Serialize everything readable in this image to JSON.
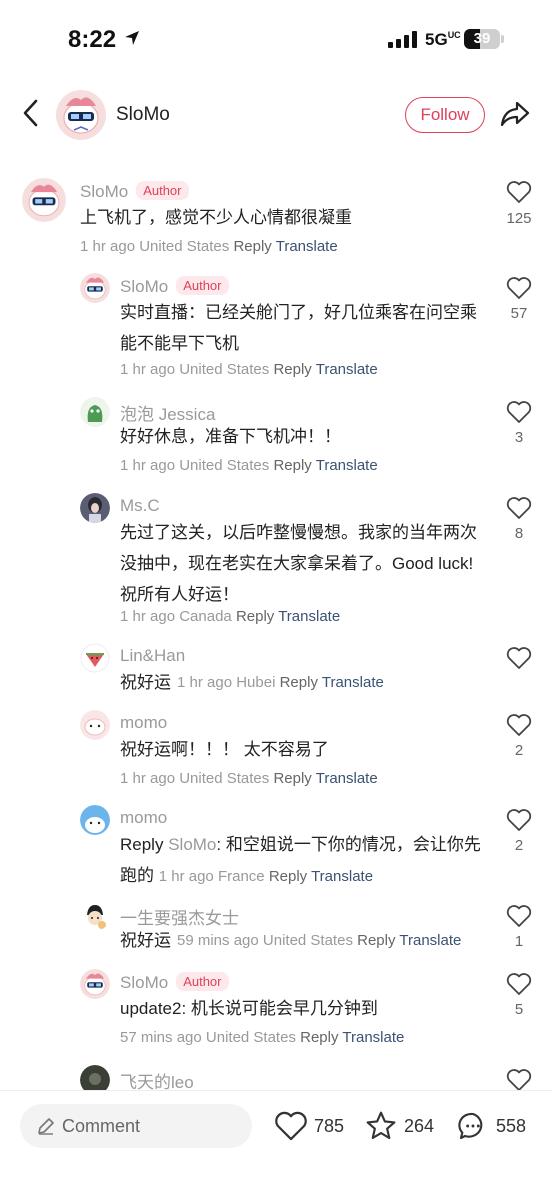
{
  "status_bar": {
    "time": "8:22",
    "network": "5G",
    "network_sub": "UC",
    "battery": "39"
  },
  "header": {
    "name": "SloMo",
    "follow_label": "Follow"
  },
  "colors": {
    "accent": "#e0405a",
    "author_badge_bg": "#fde9ec",
    "translate": "#3b5273",
    "meta": "#999999"
  },
  "meta_labels": {
    "reply": "Reply",
    "translate": "Translate",
    "author": "Author"
  },
  "comments": [
    {
      "name": "SloMo",
      "author": true,
      "text": "上飞机了，感觉不少人心情都很凝重",
      "time": "1 hr ago",
      "location": "United States",
      "likes": "125"
    },
    {
      "name": "SloMo",
      "author": true,
      "text": "实时直播：已经关舱门了，好几位乘客在问空乘能不能早下飞机",
      "time": "1 hr ago",
      "location": "United States",
      "likes": "57"
    },
    {
      "name": "泡泡 Jessica",
      "text": "好好休息，准备下飞机冲！！",
      "time": "1 hr ago",
      "location": "United States",
      "likes": "3"
    },
    {
      "name": "Ms.C",
      "text": "先过了这关，以后咋整慢慢想。我家的当年两次没抽中，现在老实在大家拿呆着了。Good luck!祝所有人好运！",
      "time": "1 hr ago",
      "location": "Canada",
      "likes": "8"
    },
    {
      "name": "Lin&Han",
      "text": "祝好运",
      "time": "1 hr ago",
      "location": "Hubei",
      "likes": ""
    },
    {
      "name": "momo",
      "text": "祝好运啊！！！ 太不容易了",
      "time": "1 hr ago",
      "location": "United States",
      "likes": "2"
    },
    {
      "name": "momo",
      "reply_prefix": "Reply",
      "reply_to": "SloMo",
      "text": ": 和空姐说一下你的情况，会让你先跑的",
      "time": "1 hr ago",
      "location": "France",
      "likes": "2"
    },
    {
      "name": "一生要强杰女士",
      "text": "祝好运",
      "time": "59 mins ago",
      "location": "United States",
      "likes": "1"
    },
    {
      "name": "SloMo",
      "author": true,
      "text": "update2: 机长说可能会早几分钟到",
      "time": "57 mins ago",
      "location": "United States",
      "likes": "5"
    },
    {
      "name": "飞天的leo",
      "likes": ""
    }
  ],
  "bottom_bar": {
    "comment_placeholder": "Comment",
    "likes": "785",
    "favorites": "264",
    "comments": "558"
  },
  "icons": [
    "location-arrow-icon",
    "signal-icon",
    "battery-icon",
    "back-icon",
    "share-icon",
    "heart-icon",
    "star-icon",
    "chat-bubble-icon",
    "pen-icon"
  ]
}
